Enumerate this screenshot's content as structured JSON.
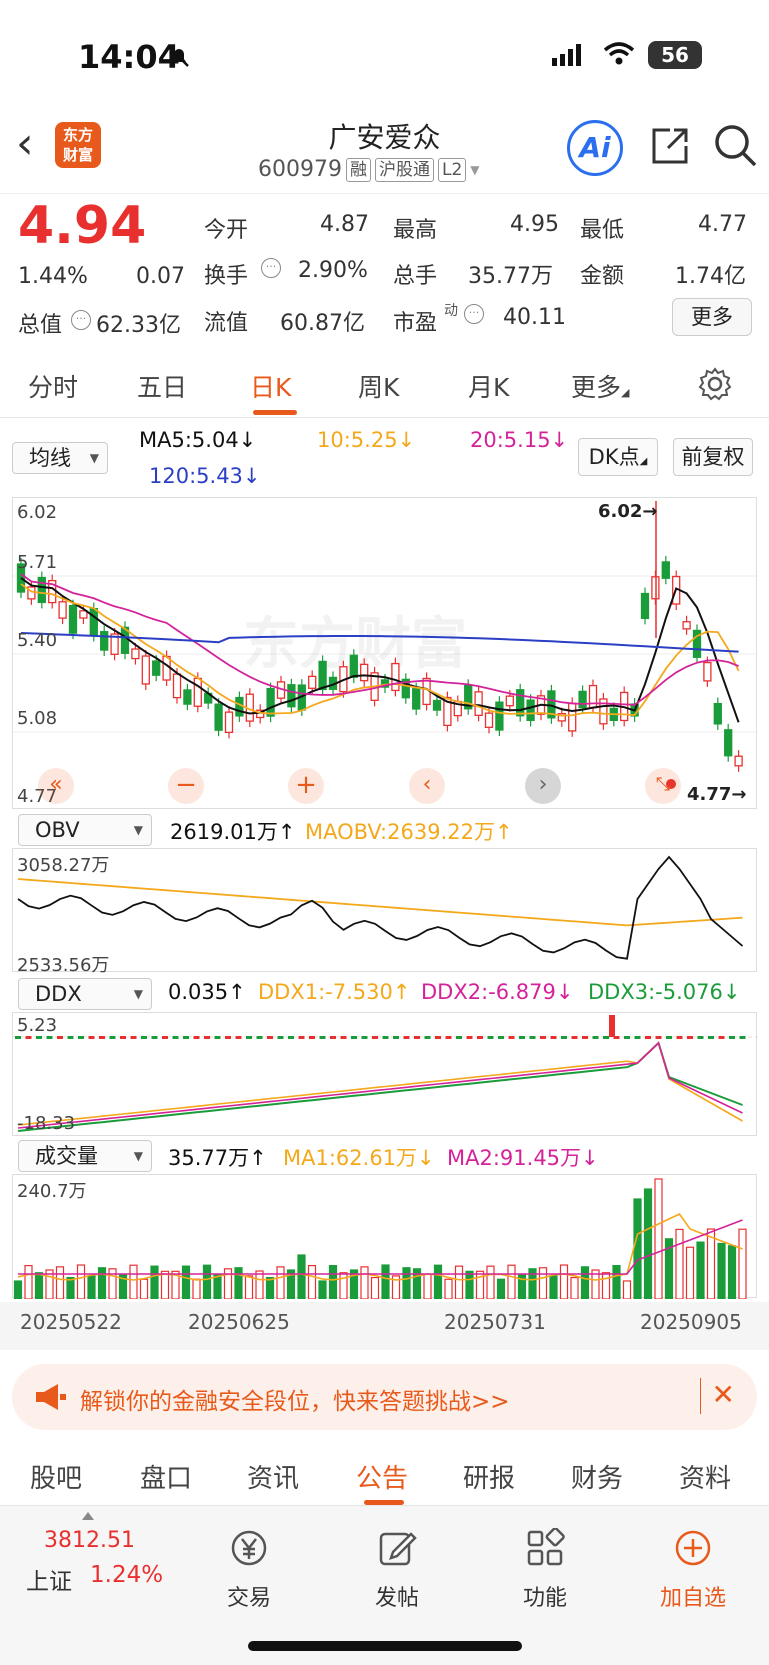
{
  "status": {
    "time": "14:04",
    "battery": "56"
  },
  "header": {
    "logo_line1": "东方",
    "logo_line2": "财富",
    "name": "广安爱众",
    "code": "600979",
    "tags": [
      "融",
      "沪股通",
      "L2"
    ],
    "ai_label": "Ai"
  },
  "quote": {
    "price": "4.94",
    "change_pct": "1.44%",
    "change": "0.07",
    "open_label": "今开",
    "open": "4.87",
    "high_label": "最高",
    "high": "4.95",
    "low_label": "最低",
    "low": "4.77",
    "turnover_label": "换手",
    "turnover": "2.90%",
    "volume_label": "总手",
    "volume": "35.77万",
    "amount_label": "金额",
    "amount": "1.74亿",
    "mcap_label": "总值",
    "mcap": "62.33亿",
    "float_label": "流值",
    "float": "60.87亿",
    "pe_label": "市盈",
    "pe_sup": "动",
    "pe": "40.11",
    "more_label": "更多"
  },
  "period_tabs": [
    "分时",
    "五日",
    "日K",
    "周K",
    "月K",
    "更多"
  ],
  "ma_row": {
    "select": "均线",
    "ma5": "MA5:5.04↓",
    "ma10": "10:5.25↓",
    "ma20": "20:5.15↓",
    "ma120": "120:5.43↓",
    "dk_label": "DK点",
    "adj_label": "前复权"
  },
  "kline": {
    "y_labels": [
      "6.02",
      "5.71",
      "5.40",
      "5.08",
      "4.77"
    ],
    "max_label": "6.02→",
    "min_label": "4.77→",
    "watermark": "东方财富"
  },
  "obv": {
    "select": "OBV",
    "value": "2619.01万↑",
    "maobv": "MAOBV:2639.22万↑",
    "y_top": "3058.27万",
    "y_bottom": "2533.56万"
  },
  "ddx": {
    "select": "DDX",
    "value": "0.035↑",
    "ddx1": "DDX1:-7.530↑",
    "ddx2": "DDX2:-6.879↓",
    "ddx3": "DDX3:-5.076↓",
    "y_top": "5.23",
    "y_bottom": "-18.33"
  },
  "volume": {
    "select": "成交量",
    "value": "35.77万↑",
    "ma1": "MA1:62.61万↓",
    "ma2": "MA2:91.45万↓",
    "y_top": "240.7万",
    "dates": [
      "20250522",
      "20250625",
      "20250731",
      "20250905"
    ]
  },
  "banner": {
    "text": "解锁你的金融安全段位，快来答题挑战>>"
  },
  "bottom_tabs": [
    "股吧",
    "盘口",
    "资讯",
    "公告",
    "研报",
    "财务",
    "资料"
  ],
  "footer": {
    "index_value": "3812.51",
    "index_name": "上证",
    "index_change": "1.24%",
    "items": [
      "交易",
      "发帖",
      "功能",
      "加自选"
    ]
  },
  "colors": {
    "up": "#e8312f",
    "down": "#1b9c3a",
    "accent": "#e85a1b",
    "ma5": "#111111",
    "ma10": "#f4a81b",
    "ma20": "#d4239a",
    "ma120": "#2b3fc4"
  }
}
